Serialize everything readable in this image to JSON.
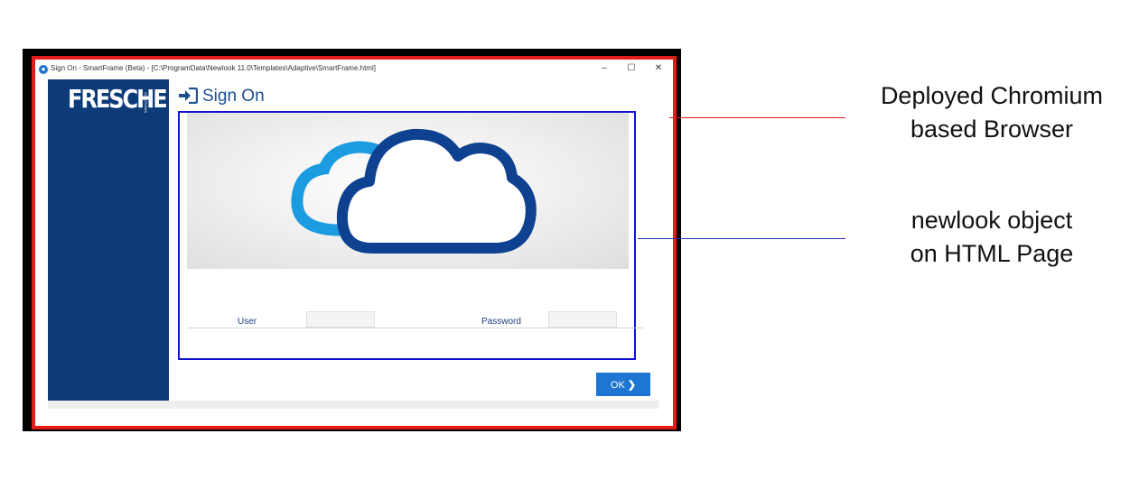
{
  "window": {
    "title": "Sign On - SmartFrame (Beta) - [C:\\ProgramData\\Newlook 11.0\\Templates\\Adaptive\\SmartFrame.html]",
    "minimize_glyph": "–",
    "maximize_glyph": "☐",
    "close_glyph": "✕"
  },
  "sidebar": {
    "logo_text": "FRESCHE",
    "logo_sub": "SOLUTIONS"
  },
  "page": {
    "title": "Sign On"
  },
  "form": {
    "user_label": "User",
    "user_value": "",
    "password_label": "Password",
    "password_value": "",
    "ok_label": "OK"
  },
  "annotations": {
    "browser": [
      "Deployed Chromium",
      "based Browser"
    ],
    "object": [
      "newlook object",
      "on HTML Page"
    ]
  },
  "colors": {
    "frame_red": "#e31b1b",
    "object_blue": "#1111cc",
    "sidebar_navy": "#0d3b78",
    "cloud_dark": "#0e418f",
    "cloud_light": "#1d9be0",
    "ok_button": "#1e76d2"
  }
}
